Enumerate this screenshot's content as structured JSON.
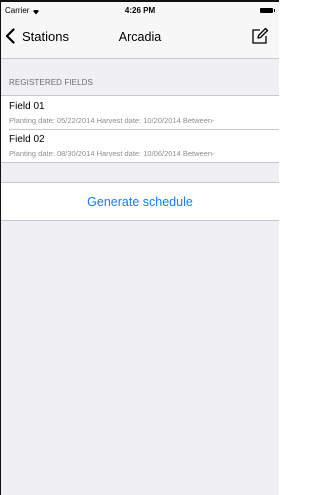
{
  "status_bar": {
    "carrier": "Carrier",
    "time": "4:26 PM"
  },
  "nav": {
    "back_label": "Stations",
    "title": "Arcadia",
    "compose_icon": "compose-icon"
  },
  "section": {
    "header": "REGISTERED FIELDS"
  },
  "fields": [
    {
      "name": "Field 01",
      "details": "Planting date: 05/22/2014  Harvest date: 10/20/2014  Between-"
    },
    {
      "name": "Field 02",
      "details": "Planting date: 08/30/2014  Harvest date: 10/06/2014  Between-"
    }
  ],
  "actions": {
    "generate_label": "Generate schedule"
  },
  "colors": {
    "accent": "#1a7cf4",
    "background": "#efeff4"
  }
}
